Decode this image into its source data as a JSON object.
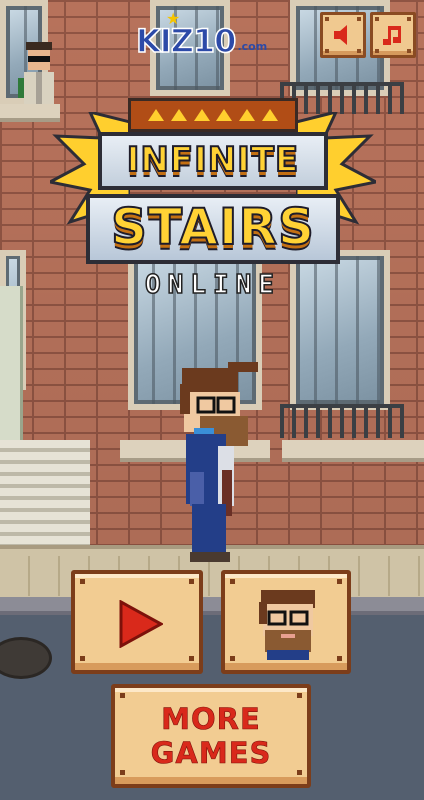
{
  "logo": {
    "brand": "KIZ10",
    "suffix": ".com"
  },
  "title": {
    "line1": "INFINITE",
    "line2": "STAIRS",
    "line3": "ONLINE"
  },
  "buttons": {
    "sound": {
      "icon": "speaker-icon"
    },
    "music": {
      "icon": "music-note-icon"
    },
    "play": {
      "icon": "play-icon"
    },
    "character": {
      "icon": "character-portrait-icon"
    },
    "more_games": {
      "line1": "MORE",
      "line2": "GAMES"
    }
  },
  "colors": {
    "accent_red": "#d9291b",
    "button_face": "#f2cc92",
    "title_yellow": "#ffd235"
  }
}
